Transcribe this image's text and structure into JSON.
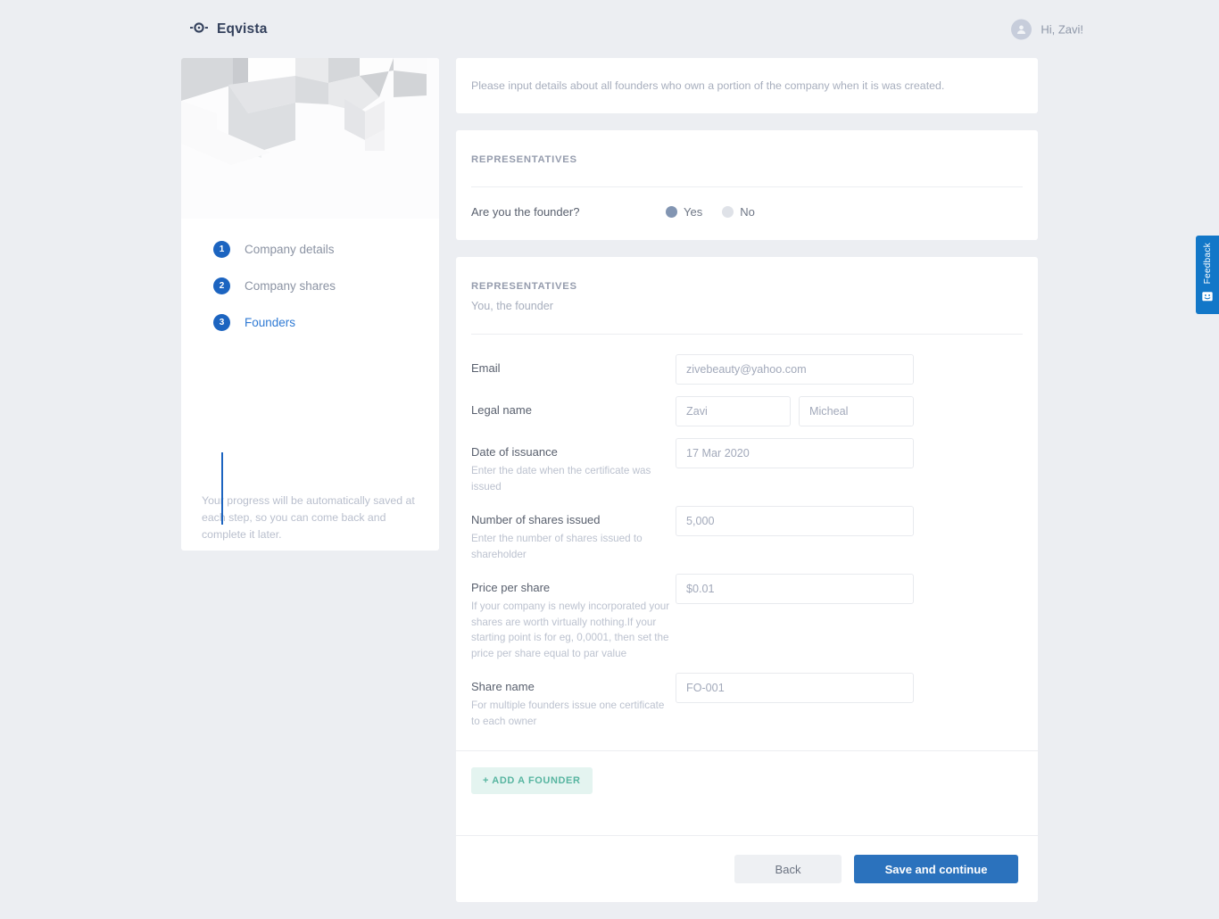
{
  "header": {
    "brand_name": "Eqvista",
    "logo_icon": "eqvista-target-icon",
    "user_greeting": "Hi, Zavi!",
    "avatar_icon": "user-avatar-icon"
  },
  "sidebar": {
    "hero_icon": "isometric-cubes-illustration",
    "steps": [
      {
        "number": "1",
        "label": "Company details",
        "current": false
      },
      {
        "number": "2",
        "label": "Company shares",
        "current": false
      },
      {
        "number": "3",
        "label": "Founders",
        "current": true
      }
    ],
    "note": "Your progress will be automatically saved at each step, so you can come back and complete it later."
  },
  "intro": {
    "text": "Please input details about all founders who own a portion of the company when it is was created."
  },
  "founder_question_card": {
    "title": "REPRESENTATIVES",
    "question": "Are you the founder?",
    "options": [
      {
        "label": "Yes",
        "selected": true
      },
      {
        "label": "No",
        "selected": false
      }
    ]
  },
  "representatives_card": {
    "title": "REPRESENTATIVES",
    "subtitle": "You, the founder",
    "fields": {
      "email": {
        "label": "Email",
        "value": "zivebeauty@yahoo.com"
      },
      "legal_name": {
        "label": "Legal name",
        "first_value": "Zavi",
        "last_value": "Micheal"
      },
      "date_of_issuance": {
        "label": "Date of issuance",
        "help": "Enter the date when the certificate was issued",
        "value": "17 Mar 2020"
      },
      "shares_issued": {
        "label": "Number of shares issued",
        "help": "Enter the number of shares issued to shareholder",
        "value": "5,000"
      },
      "price_per_share": {
        "label": "Price per share",
        "help": "If your company is newly incorporated your shares are worth virtually nothing.If your starting point is for eg, 0,0001, then set the price per share equal to par value",
        "value": "$0.01"
      },
      "share_name": {
        "label": "Share name",
        "help": "For multiple founders issue one certificate to each owner",
        "value": "FO-001"
      }
    },
    "add_founder_label": "+ ADD A FOUNDER"
  },
  "actions": {
    "back_label": "Back",
    "save_label": "Save and continue"
  },
  "feedback": {
    "label": "Feedback",
    "icon": "smiley-face-icon"
  },
  "colors": {
    "accent_blue": "#2b72bd",
    "step_blue": "#1c64c0",
    "add_green": "#57b5a0",
    "feedback_blue": "#1277c8",
    "page_background": "#eceef2"
  }
}
